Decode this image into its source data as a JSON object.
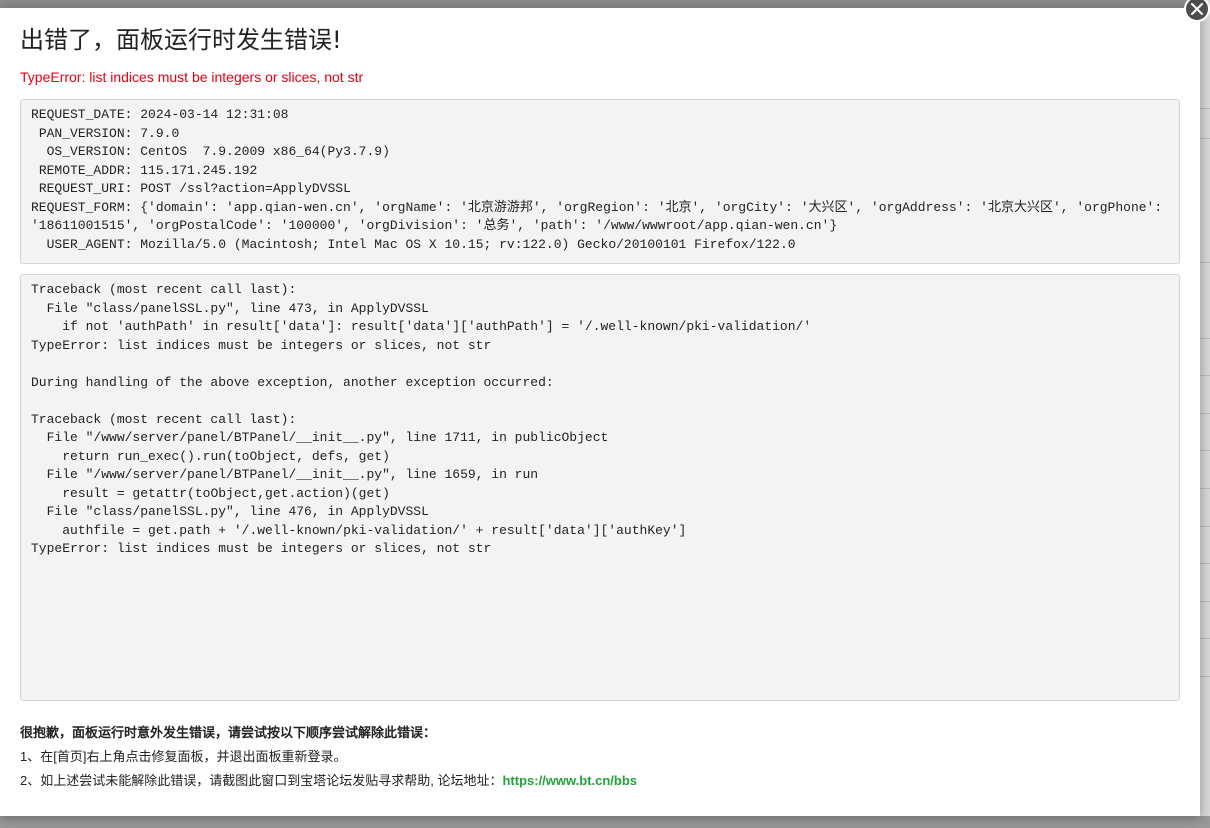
{
  "dialog": {
    "title": "出错了，面板运行时发生错误!",
    "error_message": "TypeError: list indices must be integers or slices, not str"
  },
  "request_info": [
    {
      "key": "REQUEST_DATE:",
      "value": "2024-03-14 12:31:08"
    },
    {
      "key": " PAN_VERSION:",
      "value": "7.9.0"
    },
    {
      "key": "  OS_VERSION:",
      "value": "CentOS  7.9.2009 x86_64(Py3.7.9)"
    },
    {
      "key": " REMOTE_ADDR:",
      "value": "115.171.245.192"
    },
    {
      "key": " REQUEST_URI:",
      "value": "POST /ssl?action=ApplyDVSSL"
    },
    {
      "key": "REQUEST_FORM:",
      "value": "{'domain': 'app.qian-wen.cn', 'orgName': '北京游游邦', 'orgRegion': '北京', 'orgCity': '大兴区', 'orgAddress': '北京大兴区', 'orgPhone': '18611001515', 'orgPostalCode': '100000', 'orgDivision': '总务', 'path': '/www/wwwroot/app.qian-wen.cn'}"
    },
    {
      "key": "  USER_AGENT:",
      "value": "Mozilla/5.0 (Macintosh; Intel Mac OS X 10.15; rv:122.0) Gecko/20100101 Firefox/122.0"
    }
  ],
  "traceback": "Traceback (most recent call last):\n  File \"class/panelSSL.py\", line 473, in ApplyDVSSL\n    if not 'authPath' in result['data']: result['data']['authPath'] = '/.well-known/pki-validation/'\nTypeError: list indices must be integers or slices, not str\n\nDuring handling of the above exception, another exception occurred:\n\nTraceback (most recent call last):\n  File \"/www/server/panel/BTPanel/__init__.py\", line 1711, in publicObject\n    return run_exec().run(toObject, defs, get)\n  File \"/www/server/panel/BTPanel/__init__.py\", line 1659, in run\n    result = getattr(toObject,get.action)(get)\n  File \"class/panelSSL.py\", line 476, in ApplyDVSSL\n    authfile = get.path + '/.well-known/pki-validation/' + result['data']['authKey']\nTypeError: list indices must be integers or slices, not str",
  "help": {
    "title": "很抱歉，面板运行时意外发生错误，请尝试按以下顺序尝试解除此错误：",
    "step1": "1、在[首页]右上角点击修复面板，并退出面板重新登录。",
    "step2_prefix": "2、如上述尝试未能解除此错误，请截图此窗口到宝塔论坛发贴寻求帮助, 论坛地址：",
    "forum_link": "https://www.bt.cn/bbs"
  },
  "colors": {
    "error_red": "#e60012",
    "link_green": "#20a53a"
  },
  "icons": {
    "close": "close-icon"
  }
}
